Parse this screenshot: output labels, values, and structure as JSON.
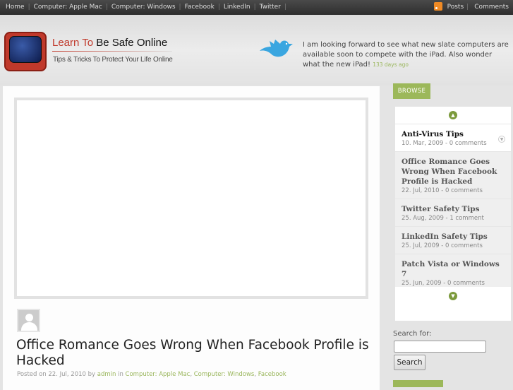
{
  "topnav": {
    "items": [
      "Home",
      "Computer: Apple Mac",
      "Computer: Windows",
      "Facebook",
      "LinkedIn",
      "Twitter"
    ],
    "posts": "Posts",
    "comments": "Comments"
  },
  "header": {
    "logo_red": "Learn To",
    "logo_black": "Be Safe Online",
    "tagline": "Tips & Tricks To Protect Your Life Online",
    "tweet": "I am looking forward to see what new slate computers are available soon to compete with the iPad. Also wonder what the new iPad!",
    "tweet_ago": "133 days ago"
  },
  "post": {
    "title": "Office Romance Goes Wrong When Facebook Profile is Hacked",
    "posted_on": "Posted on 22. Jul, 2010 by",
    "author": "admin",
    "in": "in",
    "categories": [
      "Computer: Apple Mac",
      "Computer: Windows",
      "Facebook"
    ]
  },
  "sidebar": {
    "browse": "BROWSE",
    "items": [
      {
        "title": "Anti-Virus Tips",
        "meta": "10. Mar, 2009 - 0 comments"
      },
      {
        "title": "Office Romance Goes Wrong When Facebook Profile is Hacked",
        "meta": "22. Jul, 2010 - 0 comments"
      },
      {
        "title": "Twitter Safety Tips",
        "meta": "25. Aug, 2009 - 1 comment"
      },
      {
        "title": "LinkedIn Safety Tips",
        "meta": "25. Jul, 2009 - 0 comments"
      },
      {
        "title": "Patch Vista or Windows 7",
        "meta": "25. Jun, 2009 - 0 comments"
      }
    ],
    "search_label": "Search for:",
    "search_value": "",
    "search_button": "Search"
  }
}
